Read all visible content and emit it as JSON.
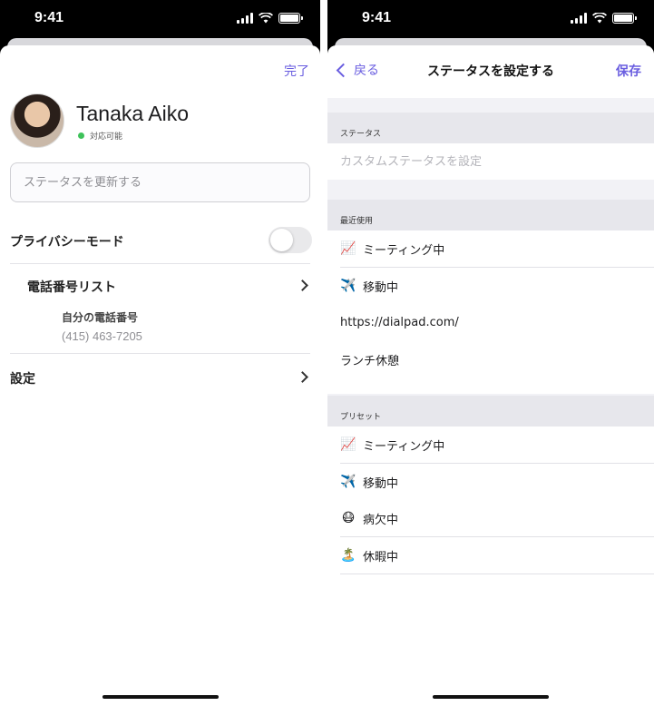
{
  "status_bar": {
    "time": "9:41"
  },
  "profile_sheet": {
    "done_label": "完了",
    "name": "Tanaka Aiko",
    "presence_text": "対応可能",
    "status_placeholder": "ステータスを更新する",
    "privacy_mode_label": "プライバシーモード",
    "privacy_mode_on": false,
    "phone_list_label": "電話番号リスト",
    "own_number_label": "自分の電話番号",
    "own_number": "(415) 463-7205",
    "settings_label": "設定"
  },
  "status_editor": {
    "back_label": "戻る",
    "title": "ステータスを設定する",
    "save_label": "保存",
    "status_section_title": "ステータス",
    "custom_placeholder": "カスタムステータスを設定",
    "recent_section_title": "最近使用",
    "recent": [
      {
        "icon": "📈",
        "label": "ミーティング中"
      },
      {
        "icon": "✈️",
        "label": "移動中"
      },
      {
        "icon": "",
        "label": "https://dialpad.com/"
      },
      {
        "icon": "",
        "label": "ランチ休憩"
      }
    ],
    "preset_section_title": "プリセット",
    "presets": [
      {
        "icon": "📈",
        "label": "ミーティング中"
      },
      {
        "icon": "✈️",
        "label": "移動中"
      },
      {
        "icon": "😷",
        "label": "病欠中"
      },
      {
        "icon": "🏝️",
        "label": "休暇中"
      }
    ]
  },
  "colors": {
    "accent": "#6a5ee0",
    "available": "#3ec25a"
  }
}
